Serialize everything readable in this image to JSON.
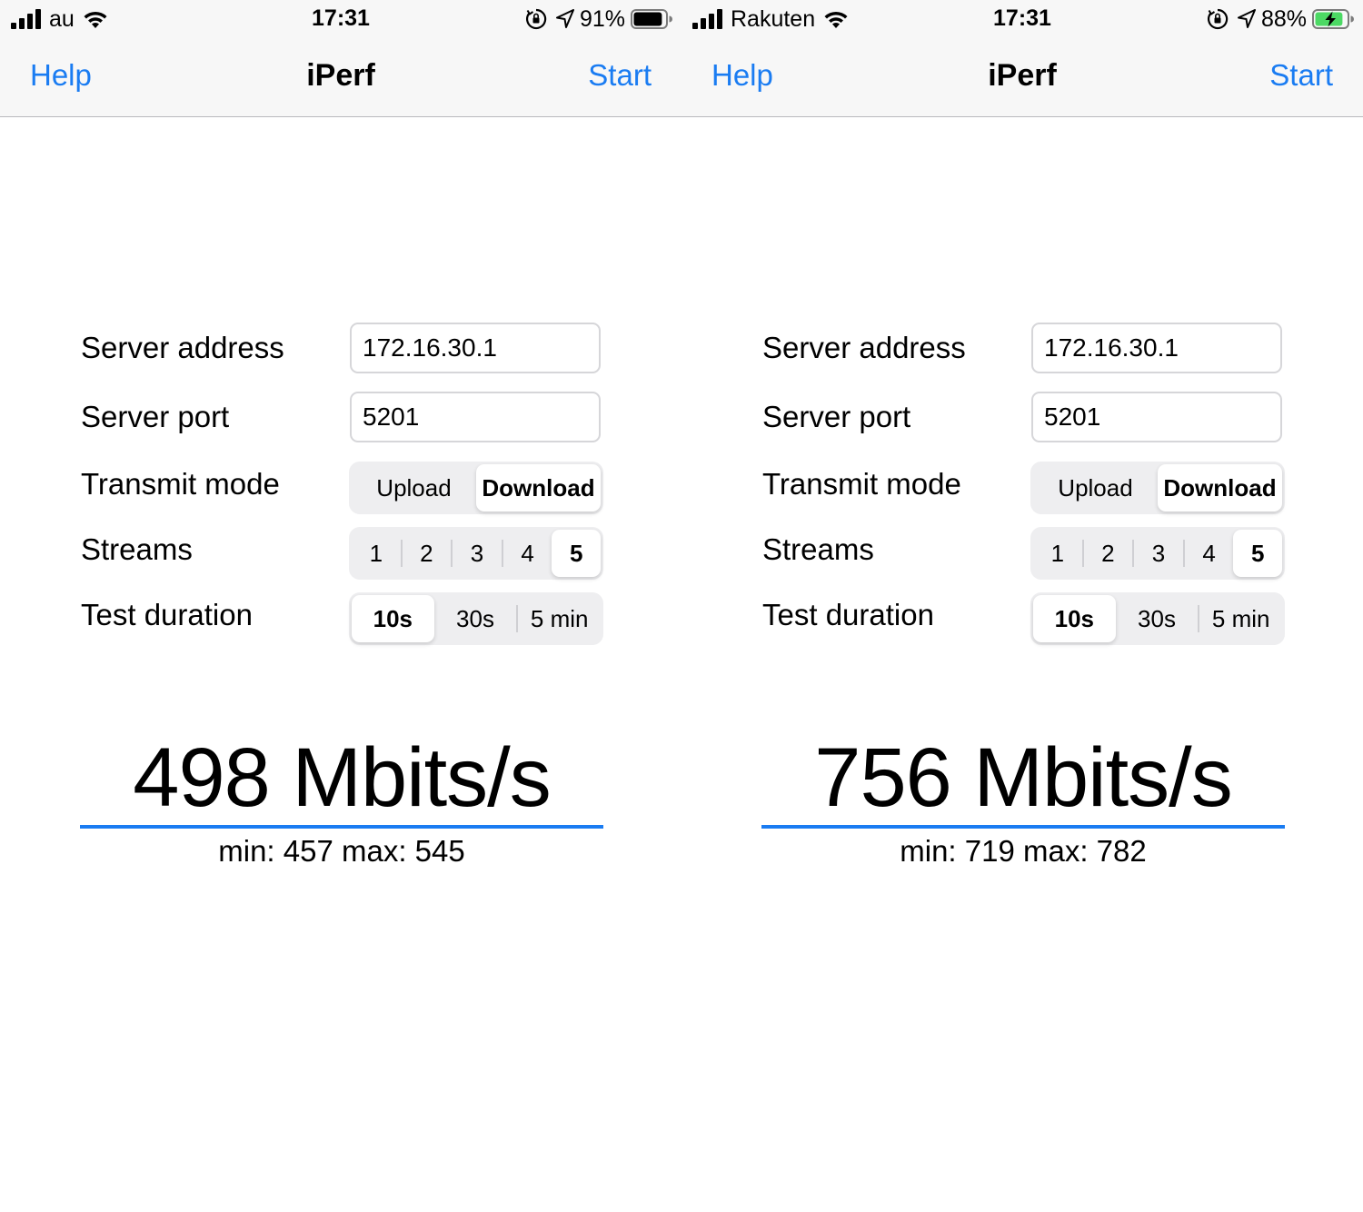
{
  "screens": [
    {
      "status": {
        "carrier": "au",
        "time": "17:31",
        "battery_pct": "91%",
        "charging": false,
        "battery_level": 0.91
      },
      "nav": {
        "left": "Help",
        "title": "iPerf",
        "right": "Start"
      },
      "form": {
        "server_address_label": "Server address",
        "server_address_value": "172.16.30.1",
        "server_port_label": "Server port",
        "server_port_value": "5201",
        "transmit_mode_label": "Transmit mode",
        "transmit_modes": [
          "Upload",
          "Download"
        ],
        "transmit_selected": "Download",
        "streams_label": "Streams",
        "streams": [
          "1",
          "2",
          "3",
          "4",
          "5"
        ],
        "streams_selected": "5",
        "duration_label": "Test duration",
        "durations": [
          "10s",
          "30s",
          "5 min"
        ],
        "duration_selected": "10s"
      },
      "result": {
        "speed": "498 Mbits/s",
        "minmax": "min: 457 max: 545"
      }
    },
    {
      "status": {
        "carrier": "Rakuten",
        "time": "17:31",
        "battery_pct": "88%",
        "charging": true,
        "battery_level": 0.88
      },
      "nav": {
        "left": "Help",
        "title": "iPerf",
        "right": "Start"
      },
      "form": {
        "server_address_label": "Server address",
        "server_address_value": "172.16.30.1",
        "server_port_label": "Server port",
        "server_port_value": "5201",
        "transmit_mode_label": "Transmit mode",
        "transmit_modes": [
          "Upload",
          "Download"
        ],
        "transmit_selected": "Download",
        "streams_label": "Streams",
        "streams": [
          "1",
          "2",
          "3",
          "4",
          "5"
        ],
        "streams_selected": "5",
        "duration_label": "Test duration",
        "durations": [
          "10s",
          "30s",
          "5 min"
        ],
        "duration_selected": "10s"
      },
      "result": {
        "speed": "756 Mbits/s",
        "minmax": "min: 719 max: 782"
      }
    }
  ],
  "colors": {
    "accent": "#1a7cf2",
    "charging": "#4cd964"
  },
  "icons": [
    "signal-icon",
    "wifi-icon",
    "orientation-lock-icon",
    "location-arrow-icon",
    "battery-icon"
  ]
}
